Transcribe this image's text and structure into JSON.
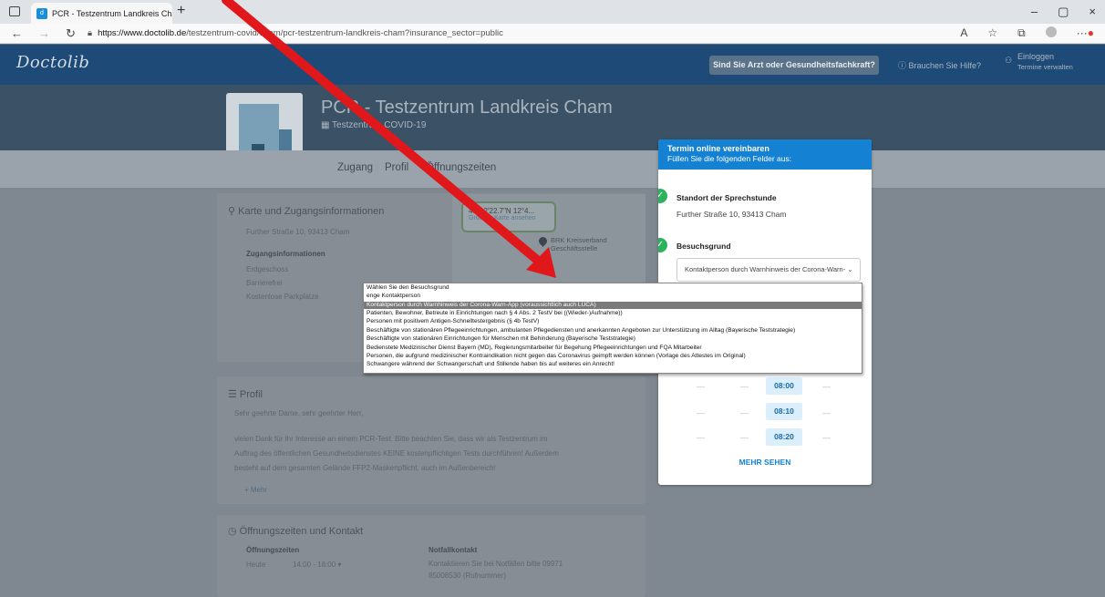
{
  "browser": {
    "tab_title": "PCR - Testzentrum Landkreis Cha",
    "tab_close": "×",
    "new_tab": "+",
    "url_domain": "https://www.doctolib.de",
    "url_path": "/testzentrum-covid/cham/pcr-testzentrum-landkreis-cham?insurance_sector=public",
    "win_min": "–",
    "win_max": "▢",
    "win_close": "×"
  },
  "header": {
    "logo": "Doctolib",
    "pro_button": "Sind Sie Arzt oder Gesundheitsfachkraft?",
    "help": "Brauchen Sie Hilfe?",
    "login": "Einloggen",
    "login_sub": "Termine verwalten"
  },
  "practice": {
    "title": "PCR - Testzentrum Landkreis Cham",
    "subtitle": "Testzentrum COVID-19",
    "tabs": [
      "Zugang",
      "Profil",
      "Öffnungszeiten"
    ]
  },
  "access": {
    "heading": "Karte und Zugangsinformationen",
    "address": "Further Straße 10, 93413 Cham",
    "info_heading": "Zugangsinformationen",
    "items": [
      "Erdgeschoss",
      "Barrierefrei",
      "Kostenlose Parkplätze"
    ],
    "map_coord": "49°12'22.7\"N 12°4...",
    "map_link": "Größere Karte ansehen",
    "map_poi": "BRK Kreisverband",
    "map_poi2": "Geschäftsstelle"
  },
  "profile": {
    "heading": "Profil",
    "greeting": "Sehr geehrte Dame, sehr geehrter Herr,",
    "text1": "vielen Dank für Ihr Interesse an einem PCR-Test. Bitte beachten Sie, dass wir als Testzentrum im",
    "text2": "Auftrag des öffentlichen Gesundheitsdienstes KEINE kostenpflichtigen Tests durchführen! Außerdem",
    "text3": "besteht auf dem gesamten Gelände FFP2-Maskenpflicht, auch im Außenbereich!",
    "more": "+ Mehr"
  },
  "hours": {
    "heading": "Öffnungszeiten und Kontakt",
    "hours_label": "Öffnungszeiten",
    "today": "Heute",
    "today_hours": "14:00 - 18:00 ▾",
    "emergency_label": "Notfallkontakt",
    "emergency_text": "Kontaktieren Sie bei Notfällen bitte 09971",
    "emergency_text2": "85008530 (Rufnummer)"
  },
  "booking": {
    "title": "Termin online vereinbaren",
    "subtitle": "Füllen Sie die folgenden Felder aus:",
    "location_label": "Standort der Sprechstunde",
    "location_value": "Further Straße 10, 93413 Cham",
    "reason_label": "Besuchsgrund",
    "reason_value": "Kontaktperson durch Warnhinweis der Corona-Warn-",
    "slots": [
      "08:00",
      "08:10",
      "08:20"
    ],
    "more": "MEHR SEHEN",
    "check_glyph": "✓",
    "dash": "—"
  },
  "dropdown": {
    "options": [
      "Wählen Sie den Besuchsgrund",
      "enge Kontaktperson",
      "Kontaktperson durch Warnhinweis der Corona-Warn-App (voraussichtlich auch LUCA)",
      "Patienten, Bewohner, Betreute in Einrichtungen nach § 4 Abs. 2 TestV bei ((Wieder-)Aufnahme))",
      "Personen mit positivem Antigen-Schnelltestergebnis (§ 4b TestV)",
      "Beschäftigte von stationären Pflegeeinrichtungen, ambulanten Pflegediensten und anerkannten Angeboten zur Unterstützung im Alltag (Bayerische Teststrategie)",
      "Beschäftigte von stationären Einrichtungen für Menschen mit Behinderung (Bayerische Teststrategie)",
      "Bedienstete Medizinischer Dienst Bayern (MD), Regierungsmitarbeiter für Begehung Pflegeeinrichtungen und FQA Mitarbeiter",
      "Personen, die aufgrund medizinischer Kontraindikation nicht gegen das Coronavirus geimpft werden können (Vorlage des Attestes im Original)",
      "Schwangere während der Schwangerschaft und Stillende haben bis auf weiteres ein Anrecht!"
    ],
    "selected_index": 2
  },
  "annotation": {
    "color": "#e0181c"
  }
}
